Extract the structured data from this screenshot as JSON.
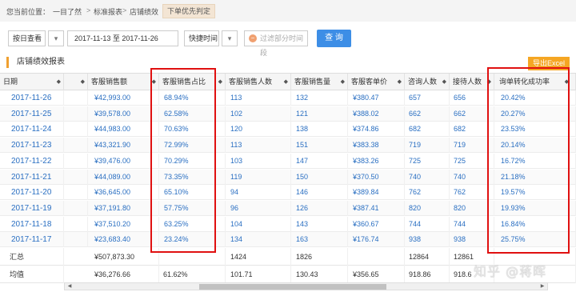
{
  "breadcrumb": {
    "label": "您当前位置：",
    "items": [
      "一目了然",
      "标准报表",
      "店铺绩效"
    ],
    "separator": ">",
    "badge": "下单优先判定"
  },
  "toolbar": {
    "view_mode": "按日查看",
    "date_range": "2017-11-13 至 2017-11-26",
    "quick_time": "快捷时间",
    "filter_label": "过滤部分时间段",
    "filter_icon": "minus-circle-icon",
    "query_label": "查 询"
  },
  "section": {
    "title": "店铺绩效报表",
    "export_label": "导出Excel"
  },
  "table": {
    "columns": [
      "日期",
      "",
      "客服销售额",
      "客服销售占比",
      "客服销售人数",
      "客服销售量",
      "客服客单价",
      "咨询人数",
      "接待人数",
      "询单转化成功率"
    ],
    "rows": [
      [
        "2017-11-26",
        "¥42,993.00",
        "68.94%",
        "113",
        "132",
        "¥380.47",
        "657",
        "656",
        "20.42%"
      ],
      [
        "2017-11-25",
        "¥39,578.00",
        "62.58%",
        "102",
        "121",
        "¥388.02",
        "662",
        "662",
        "20.27%"
      ],
      [
        "2017-11-24",
        "¥44,983.00",
        "70.63%",
        "120",
        "138",
        "¥374.86",
        "682",
        "682",
        "23.53%"
      ],
      [
        "2017-11-23",
        "¥43,321.90",
        "72.99%",
        "113",
        "151",
        "¥383.38",
        "719",
        "719",
        "20.14%"
      ],
      [
        "2017-11-22",
        "¥39,476.00",
        "70.29%",
        "103",
        "147",
        "¥383.26",
        "725",
        "725",
        "16.72%"
      ],
      [
        "2017-11-21",
        "¥44,089.00",
        "73.35%",
        "119",
        "150",
        "¥370.50",
        "740",
        "740",
        "21.18%"
      ],
      [
        "2017-11-20",
        "¥36,645.00",
        "65.10%",
        "94",
        "146",
        "¥389.84",
        "762",
        "762",
        "19.57%"
      ],
      [
        "2017-11-19",
        "¥37,191.80",
        "57.75%",
        "96",
        "126",
        "¥387.41",
        "820",
        "820",
        "19.93%"
      ],
      [
        "2017-11-18",
        "¥37,510.20",
        "63.25%",
        "104",
        "143",
        "¥360.67",
        "744",
        "744",
        "16.84%"
      ],
      [
        "2017-11-17",
        "¥23,683.40",
        "23.24%",
        "134",
        "163",
        "¥176.74",
        "938",
        "938",
        "25.75%"
      ]
    ],
    "summary": {
      "label": "汇总",
      "values": [
        "¥507,873.30",
        "",
        "1424",
        "1826",
        "",
        "12864",
        "12861",
        ""
      ]
    },
    "average": {
      "label": "均值",
      "values": [
        "¥36,276.66",
        "61.62%",
        "101.71",
        "130.43",
        "¥356.65",
        "918.86",
        "918.6",
        ""
      ]
    }
  },
  "watermark": "知乎 @蒋晖",
  "colors": {
    "link": "#2a6fc2",
    "highlight_box": "#e01010",
    "query_button": "#3d8ee6",
    "export_button": "#f5a623"
  }
}
